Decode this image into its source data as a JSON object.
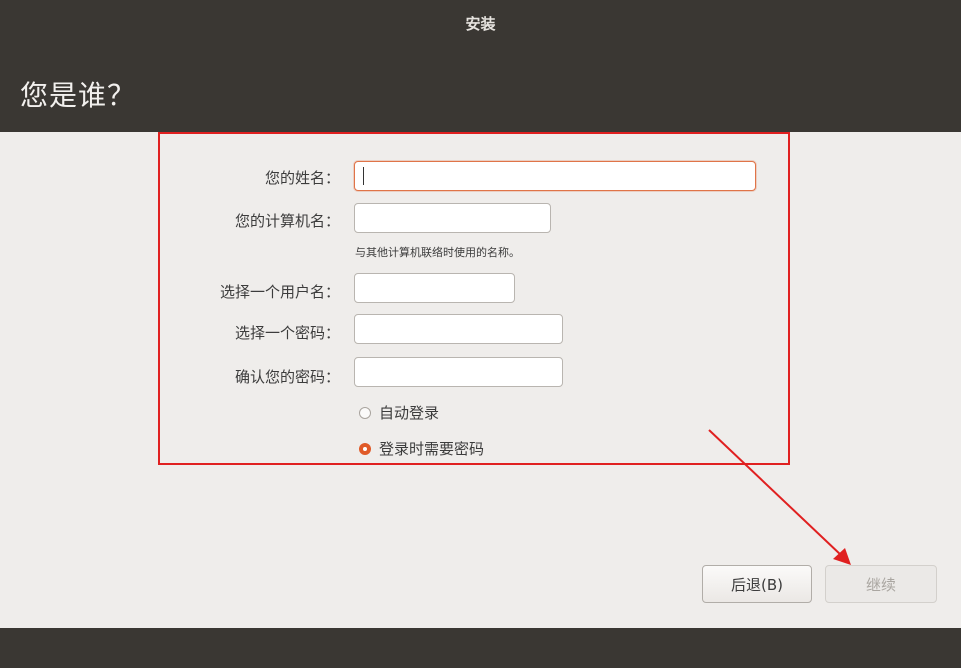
{
  "window": {
    "title": "安装"
  },
  "header": {
    "page_title": "您是谁？"
  },
  "form": {
    "name_label": "您的姓名：",
    "name_value": "",
    "computer_name_label": "您的计算机名：",
    "computer_name_value": "",
    "computer_name_hint": "与其他计算机联络时使用的名称。",
    "username_label": "选择一个用户名：",
    "username_value": "",
    "password_label": "选择一个密码：",
    "password_value": "",
    "confirm_password_label": "确认您的密码：",
    "confirm_password_value": "",
    "login_options": [
      {
        "label": "自动登录",
        "selected": false
      },
      {
        "label": "登录时需要密码",
        "selected": true
      }
    ]
  },
  "buttons": {
    "back_label": "后退(B)",
    "continue_label": "继续",
    "continue_enabled": false
  },
  "colors": {
    "titlebar_bg": "#3a3733",
    "content_bg": "#efedeb",
    "focus_border": "#e07448",
    "radio_selected": "#e05a28",
    "annotation_red": "#e02020"
  },
  "annotations": {
    "highlight_box": true,
    "arrow_to_continue": true
  }
}
